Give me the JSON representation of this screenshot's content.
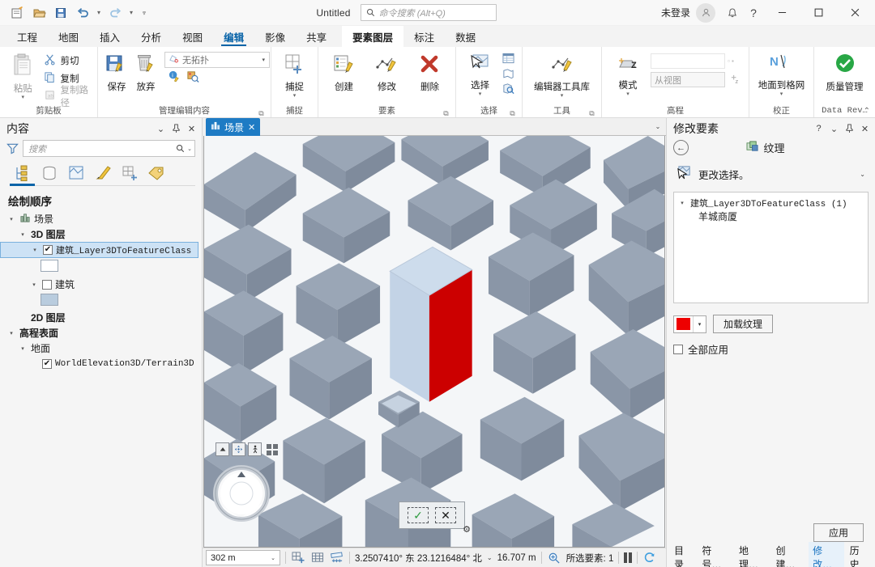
{
  "titlebar": {
    "quick_access": [
      {
        "name": "new-project-icon",
        "label": "新建工程"
      },
      {
        "name": "open-project-icon",
        "label": "打开工程"
      },
      {
        "name": "save-project-icon",
        "label": "保存工程"
      },
      {
        "name": "undo-icon",
        "label": "撤消"
      },
      {
        "name": "redo-icon",
        "label": "恢复"
      },
      {
        "name": "customize-qat-icon",
        "label": "自定义快速访问工具栏"
      }
    ],
    "doc_title": "Untitled",
    "search_placeholder": "命令搜索 (Alt+Q)",
    "sign_in": "未登录",
    "account_icon": "account-icon",
    "notification_icon": "bell-icon",
    "help_icon": "help-icon",
    "minimize": "—",
    "maximize": "□",
    "close": "✕"
  },
  "ribbon": {
    "tabs": [
      {
        "label": "工程",
        "active": false
      },
      {
        "label": "地图",
        "active": false
      },
      {
        "label": "插入",
        "active": false
      },
      {
        "label": "分析",
        "active": false
      },
      {
        "label": "视图",
        "active": false
      },
      {
        "label": "编辑",
        "active": true
      },
      {
        "label": "影像",
        "active": false
      },
      {
        "label": "共享",
        "active": false
      }
    ],
    "contextual_tabs": [
      {
        "label": "要素图层",
        "active": true
      },
      {
        "label": "标注",
        "active": false
      },
      {
        "label": "数据",
        "active": false
      }
    ],
    "collapse_icon": "chevron-up-icon",
    "groups": [
      {
        "label": "剪贴板",
        "big": {
          "label": "粘贴",
          "icon": "paste-icon",
          "has_dropdown": true,
          "dim": true
        },
        "small": [
          {
            "label": "剪切",
            "icon": "cut-icon",
            "dim": false
          },
          {
            "label": "复制",
            "icon": "copy-icon",
            "dim": false
          },
          {
            "label": "复制路径",
            "icon": "copy-path-icon",
            "dim": true
          }
        ]
      },
      {
        "label": "管理编辑内容",
        "buttons": [
          {
            "label": "保存",
            "icon": "save-edits-icon"
          },
          {
            "label": "放弃",
            "icon": "discard-edits-icon"
          }
        ],
        "topology": {
          "value": "无拓扑",
          "icon": "topology-icon"
        },
        "extra_icons": [
          {
            "name": "edit-status-icon"
          },
          {
            "name": "error-inspector-icon"
          }
        ],
        "dialog_launcher": true
      },
      {
        "label": "捕捉",
        "big": {
          "label": "捕捉",
          "icon": "snapping-icon",
          "has_dropdown": true
        }
      },
      {
        "label": "要素",
        "buttons": [
          {
            "label": "创建",
            "icon": "create-features-icon"
          },
          {
            "label": "修改",
            "icon": "modify-features-icon"
          },
          {
            "label": "删除",
            "icon": "delete-features-icon"
          }
        ],
        "dialog_launcher": true
      },
      {
        "label": "选择",
        "big": {
          "label": "选择",
          "icon": "select-icon",
          "has_dropdown": true
        },
        "extra_icons": [
          {
            "name": "attribute-table-icon"
          },
          {
            "name": "select-by-location-icon"
          },
          {
            "name": "zoom-to-selection-icon"
          }
        ],
        "dialog_launcher": true
      },
      {
        "label": "工具",
        "big": {
          "label": "编辑器工具库",
          "icon": "editor-toolbox-icon",
          "has_dropdown": true
        },
        "dialog_launcher": true
      },
      {
        "label": "高程",
        "big": {
          "label": "模式",
          "icon": "elevation-mode-icon",
          "has_dropdown": true
        },
        "field_top": "",
        "field_value": "从视图",
        "extra_icons": [
          {
            "name": "elevation-z-icon"
          }
        ]
      },
      {
        "label": "校正",
        "big": {
          "label": "地面到格网",
          "icon": "ground-to-grid-icon",
          "has_dropdown": true
        }
      },
      {
        "label": "Data Rev…",
        "big": {
          "label": "质量管理",
          "icon": "quality-management-icon"
        }
      }
    ]
  },
  "contents_panel": {
    "title": "内容",
    "head_buttons": [
      {
        "name": "panel-menu-icon",
        "glyph": "⌄"
      },
      {
        "name": "pin-icon",
        "glyph": "⯭"
      },
      {
        "name": "close-icon",
        "glyph": "✕"
      }
    ],
    "filter_icon": "filter-icon",
    "search_placeholder": "搜索",
    "search_icon": "search-icon",
    "search_caret": "⌄",
    "tool_strip": [
      {
        "name": "list-by-drawing-order-icon",
        "active": true
      },
      {
        "name": "list-by-data-source-icon",
        "active": false
      },
      {
        "name": "list-by-selection-icon",
        "active": false
      },
      {
        "name": "list-by-editing-icon",
        "active": false
      },
      {
        "name": "list-by-snapping-icon",
        "active": false
      },
      {
        "name": "list-by-labeling-icon",
        "active": false
      }
    ],
    "heading": "绘制顺序",
    "tree": [
      {
        "label": "场景",
        "indent": 0,
        "twisty": "▾",
        "icon": "scene-icon",
        "checkbox": null,
        "selected": false
      },
      {
        "label": "3D 图层",
        "indent": 1,
        "twisty": "▾",
        "icon": null,
        "checkbox": null,
        "selected": false,
        "bold": true
      },
      {
        "label": "建筑_Layer3DToFeatureClass",
        "indent": 2,
        "twisty": "▾",
        "icon": null,
        "checkbox": true,
        "selected": true,
        "mono": true
      },
      {
        "label": "",
        "indent": 3,
        "twisty": null,
        "icon": null,
        "checkbox": null,
        "selected": false,
        "swatch": "#ffffff"
      },
      {
        "label": "建筑",
        "indent": 2,
        "twisty": "▾",
        "icon": null,
        "checkbox": false,
        "selected": false
      },
      {
        "label": "",
        "indent": 3,
        "twisty": null,
        "icon": null,
        "checkbox": null,
        "selected": false,
        "swatch": "#b9ccde"
      },
      {
        "label": "2D 图层",
        "indent": 1,
        "twisty": null,
        "icon": null,
        "checkbox": null,
        "selected": false,
        "bold": true
      },
      {
        "label": "高程表面",
        "indent": 0,
        "twisty": "▾",
        "icon": null,
        "checkbox": null,
        "selected": false,
        "bold": true
      },
      {
        "label": "地面",
        "indent": 1,
        "twisty": "▾",
        "icon": null,
        "checkbox": null,
        "selected": false
      },
      {
        "label": "WorldElevation3D/Terrain3D",
        "indent": 2,
        "twisty": null,
        "icon": null,
        "checkbox": true,
        "selected": false,
        "mono": true
      }
    ]
  },
  "view": {
    "tab_label": "场景",
    "tab_icon": "scene-tab-icon",
    "tab_close": "✕",
    "tab_caret": "⌄",
    "nav_buttons": [
      {
        "name": "navigator-up-icon",
        "glyph": "▲"
      },
      {
        "name": "pan-icon",
        "glyph": "✥"
      },
      {
        "name": "walk-mode-icon",
        "glyph": "🚶"
      }
    ],
    "full_extent_icon": "full-extent-icon",
    "compass_icon": "compass-navigator",
    "finish_buttons": [
      {
        "name": "finish-edit-button",
        "glyph": "✓"
      },
      {
        "name": "cancel-edit-button",
        "glyph": "✕"
      }
    ],
    "gear_icon": "gear-icon",
    "selected_building_color": "#cc0000",
    "building_color": "#8b97a9",
    "ground_color": "#ffffff"
  },
  "statusbar": {
    "scale": "302 m",
    "scale_caret": "⌄",
    "icons": [
      {
        "name": "add-grid-icon"
      },
      {
        "name": "show-grid-icon"
      },
      {
        "name": "measure-icon"
      }
    ],
    "coordinates": "3.2507410° 东 23.1216484° 北",
    "coord_caret": "⌄",
    "elevation": "16.707 m",
    "selection_icon": "selected-features-icon",
    "selection_text": "所选要素: 1",
    "pause_icon": "pause-drawing-icon",
    "refresh_icon": "refresh-icon"
  },
  "modify_panel": {
    "title": "修改要素",
    "head_buttons": [
      {
        "name": "help-icon",
        "glyph": "?"
      },
      {
        "name": "panel-menu-icon",
        "glyph": "⌄"
      },
      {
        "name": "pin-icon",
        "glyph": "⯭"
      },
      {
        "name": "close-icon",
        "glyph": "✕"
      }
    ],
    "back_icon": "back-arrow-icon",
    "tool_title": "纹理",
    "tool_icon": "texture-icon",
    "change_selection_label": "更改选择。",
    "change_selection_icon": "select-tool-icon",
    "change_selection_caret": "⌄",
    "selection_list": {
      "group_label": "建筑_Layer3DToFeatureClass (1)",
      "group_twisty": "▾",
      "items": [
        "羊城商厦"
      ]
    },
    "color_swatch": "#ee0000",
    "color_caret": "▾",
    "load_texture_button": "加载纹理",
    "apply_all_label": "全部应用",
    "apply_all_checked": false,
    "apply_button": "应用",
    "bottom_tabs": [
      {
        "label": "目录",
        "active": false
      },
      {
        "label": "符号…",
        "active": false
      },
      {
        "label": "地理…",
        "active": false
      },
      {
        "label": "创建…",
        "active": false
      },
      {
        "label": "修改…",
        "active": true
      },
      {
        "label": "历史",
        "active": false
      }
    ]
  }
}
